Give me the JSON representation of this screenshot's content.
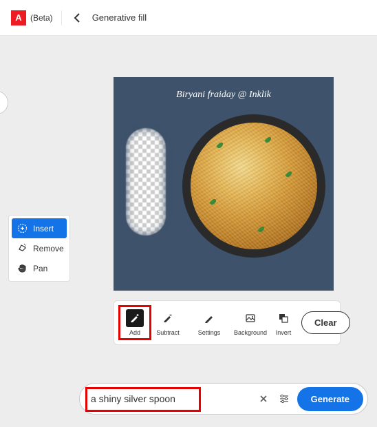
{
  "header": {
    "beta_label": "(Beta)",
    "title": "Generative fill"
  },
  "canvas": {
    "image_title": "Biryani fraiday @ Inklik"
  },
  "sidebar": {
    "items": [
      {
        "label": "Insert",
        "icon": "insert-icon",
        "active": true
      },
      {
        "label": "Remove",
        "icon": "remove-icon",
        "active": false
      },
      {
        "label": "Pan",
        "icon": "pan-icon",
        "active": false
      }
    ]
  },
  "toolbar": {
    "items": [
      {
        "label": "Add",
        "active": true,
        "highlighted": true
      },
      {
        "label": "Subtract",
        "active": false,
        "highlighted": false
      },
      {
        "label": "Settings",
        "active": false,
        "highlighted": false
      },
      {
        "label": "Background",
        "active": false,
        "highlighted": false
      },
      {
        "label": "Invert",
        "active": false,
        "highlighted": false
      }
    ],
    "clear_label": "Clear"
  },
  "prompt": {
    "value": "a shiny silver spoon",
    "generate_label": "Generate"
  }
}
